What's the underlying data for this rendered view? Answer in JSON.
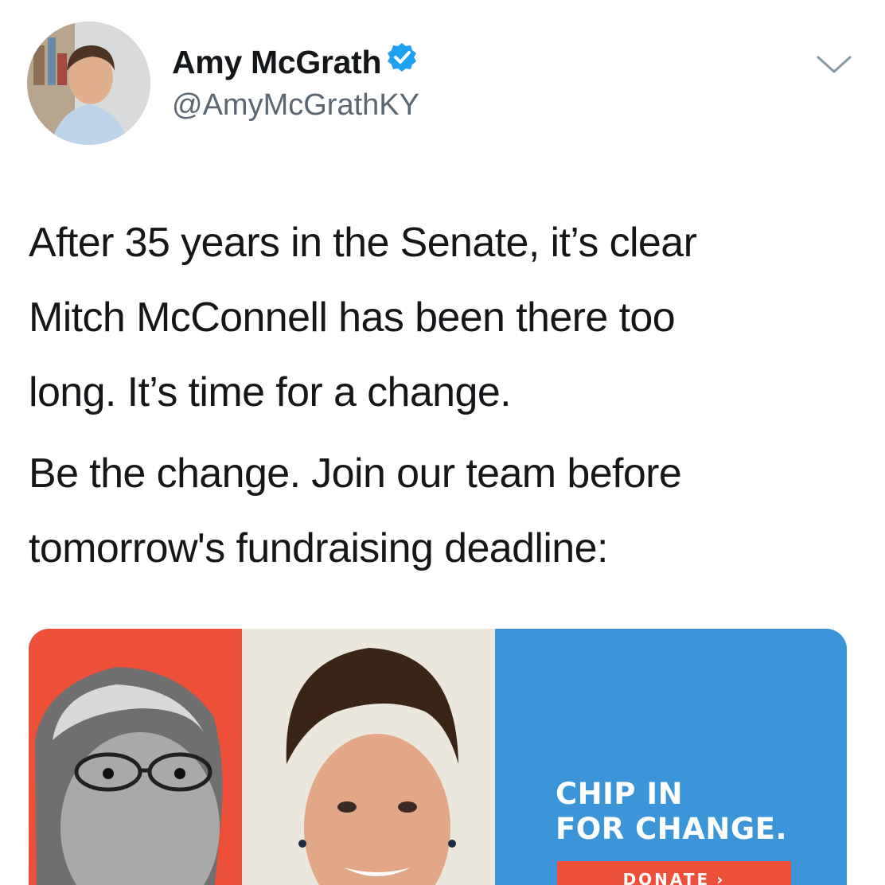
{
  "header": {
    "display_name": "Amy McGrath",
    "handle": "@AmyMcGrathKY",
    "verified_icon": "verified-badge-icon",
    "menu_icon": "chevron-down-icon"
  },
  "tweet": {
    "paragraphs": [
      "After 35 years in the Senate, it’s clear\nMitch McConnell has been there too\nlong. It’s time for a change.",
      "Be the change. Join our team before\ntomorrow's fundraising deadline:"
    ]
  },
  "card": {
    "headline_line1": "CHIP IN",
    "headline_line2": "FOR CHANGE.",
    "button_label": "DONATE",
    "button_arrow": "›"
  },
  "colors": {
    "text_primary": "#14171a",
    "text_secondary": "#5b6670",
    "verified_blue": "#1da1f2",
    "card_red": "#ee4f38",
    "card_blue": "#3c95d9"
  }
}
